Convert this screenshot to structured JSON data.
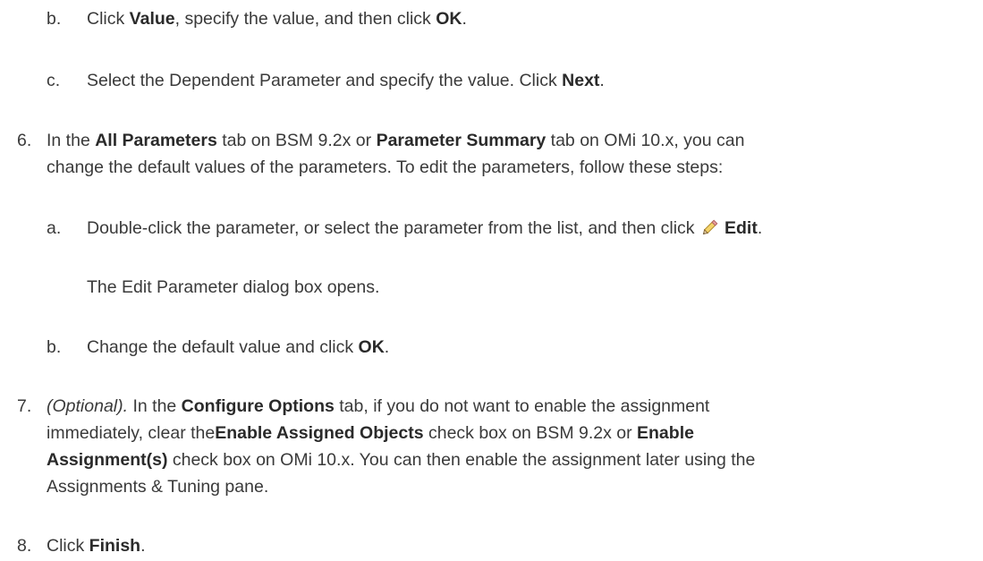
{
  "steps": {
    "s5b": {
      "marker": "b.",
      "t1": "Click ",
      "b1": "Value",
      "t2": ", specify the value, and then click ",
      "b2": "OK",
      "t3": "."
    },
    "s5c": {
      "marker": "c.",
      "t1": "Select the Dependent Parameter and specify the value. Click ",
      "b1": "Next",
      "t2": "."
    },
    "s6": {
      "marker": "6.",
      "t1": "In the ",
      "b1": "All Parameters",
      "t2": " tab on BSM 9.2x or ",
      "b2": "Parameter Summary",
      "t3": " tab on OMi 10.x, you can",
      "line2": "change the default values of the parameters. To edit the parameters, follow these steps:"
    },
    "s6a": {
      "marker": "a.",
      "t1": "Double-click the parameter, or select the parameter from the list, and then click",
      "icon": "pencil-edit-icon",
      "b1": "Edit",
      "t2": "."
    },
    "s6a_note": "The Edit Parameter dialog box opens.",
    "s6b": {
      "marker": "b.",
      "t1": "Change the default value and click ",
      "b1": "OK",
      "t2": "."
    },
    "s7": {
      "marker": "7.",
      "i1": "(Optional).",
      "t1": " In the ",
      "b1": "Configure Options",
      "t2": " tab, if you do not want to enable the assignment",
      "l2_t1": "immediately, clear the",
      "l2_b1": "Enable Assigned Objects",
      "l2_t2": " check box on BSM 9.2x or ",
      "l2_b2": "Enable",
      "l3_b1": "Assignment(s)",
      "l3_t1": " check box on OMi 10.x. You can then enable the assignment later using the",
      "l4_t1": "Assignments & Tuning pane."
    },
    "s8": {
      "marker": "8.",
      "t1": "Click ",
      "b1": "Finish",
      "t2": "."
    }
  }
}
